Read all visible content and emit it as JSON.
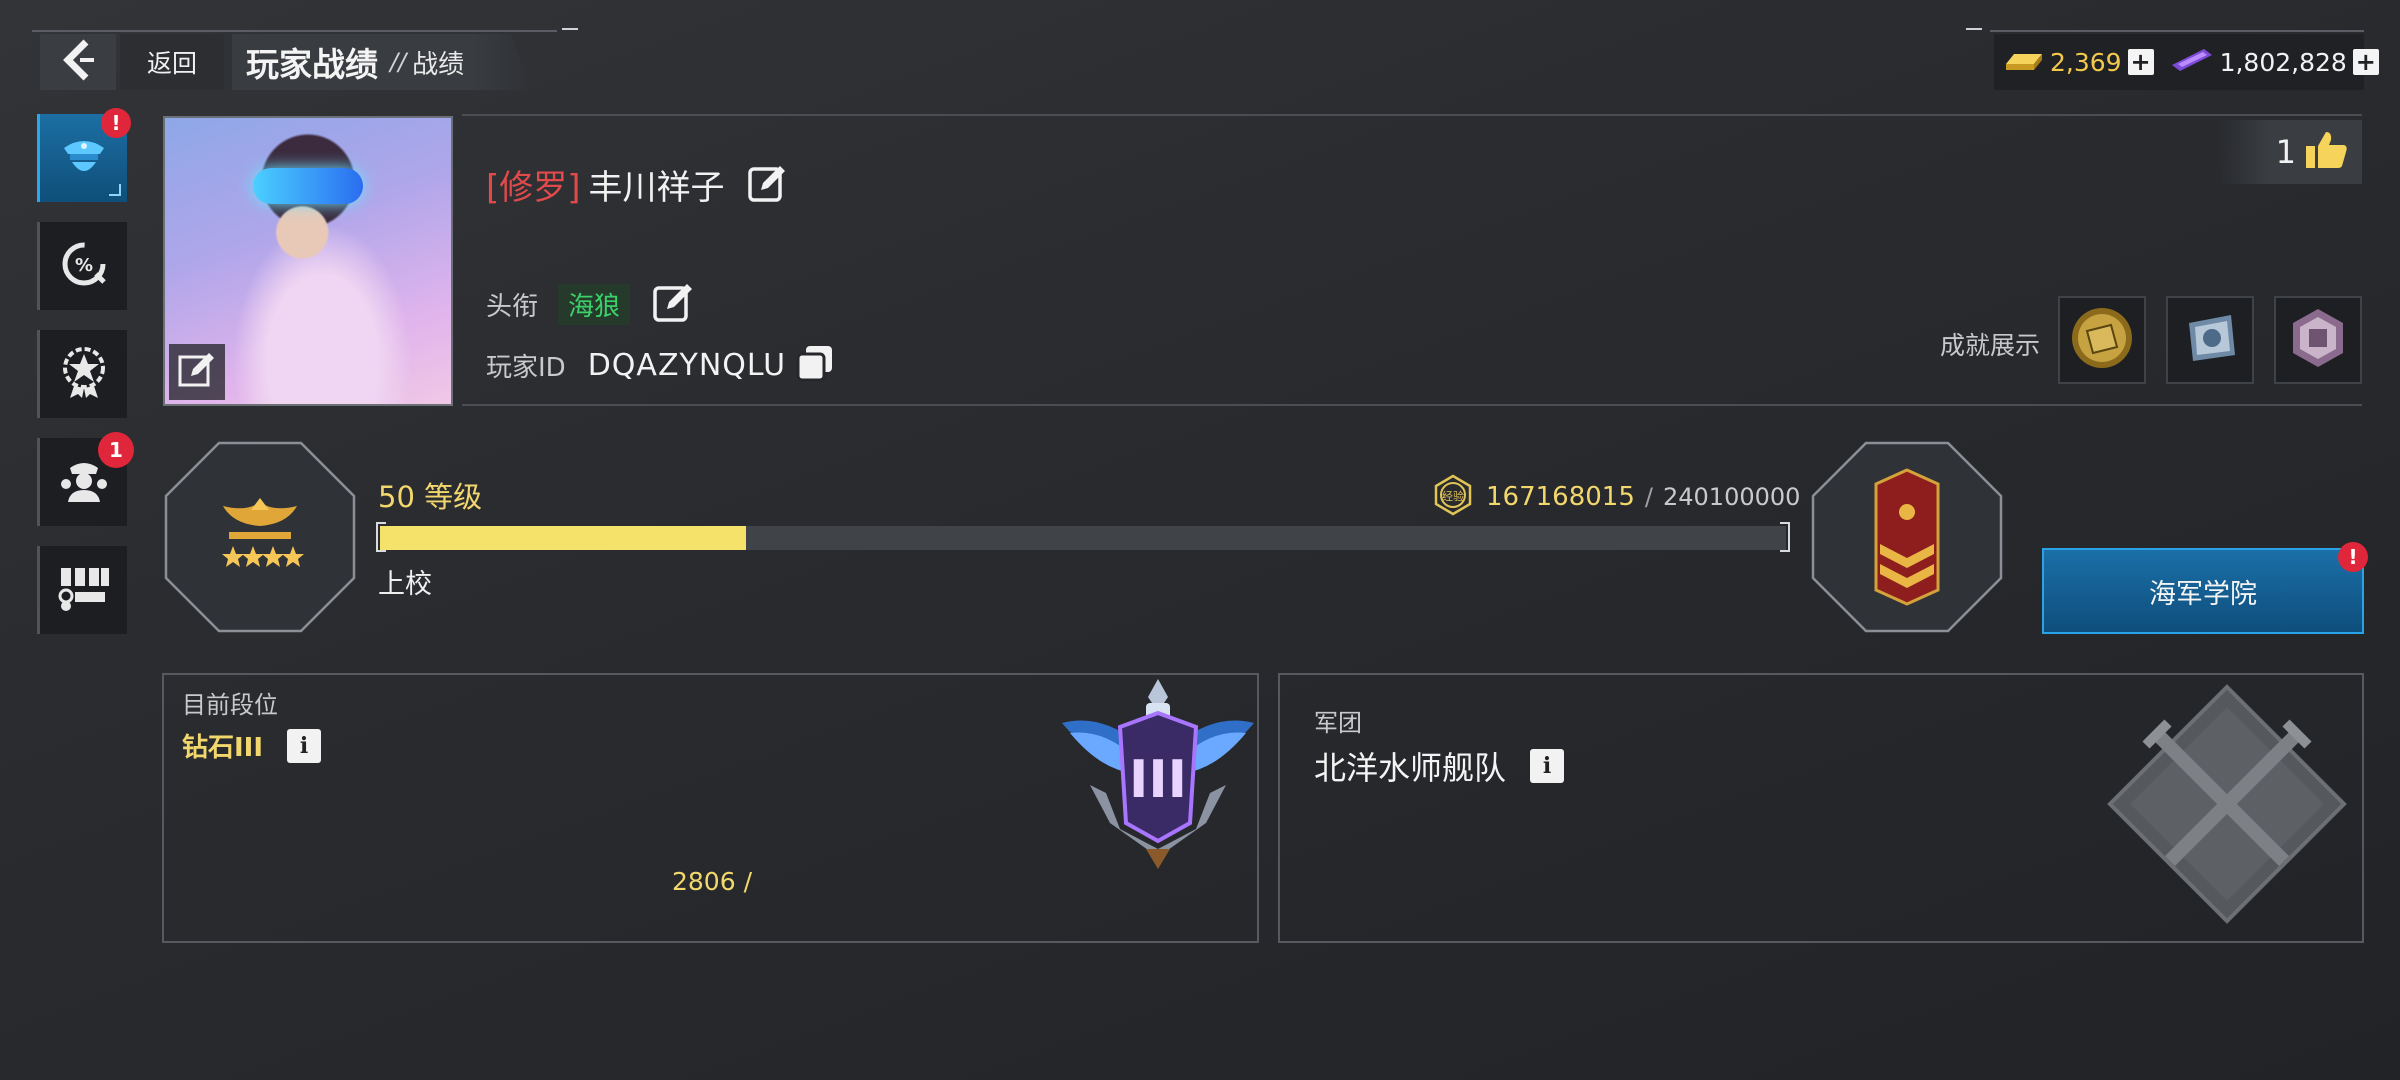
{
  "header": {
    "back_label": "返回",
    "title": "玩家战绩",
    "separator": "//",
    "subtitle": "战绩"
  },
  "currency": {
    "gold": "2,369",
    "gems": "1,802,828"
  },
  "nav": {
    "items": [
      {
        "icon": "officer-cap-icon",
        "badge": "!",
        "active": true
      },
      {
        "icon": "percent-gauge-icon",
        "badge": ""
      },
      {
        "icon": "medal-star-icon",
        "badge": ""
      },
      {
        "icon": "crew-icon",
        "badge": "1"
      },
      {
        "icon": "medals-rack-icon",
        "badge": ""
      }
    ]
  },
  "profile": {
    "name_tag": "[修罗]",
    "name": "丰川祥子",
    "title_label": "头衔",
    "title_value": "海狼",
    "id_label": "玩家ID",
    "id_value": "DQAZYNQLU",
    "likes": "1",
    "achievements_label": "成就展示"
  },
  "level": {
    "level_text": "50 等级",
    "exp_current": "167168015",
    "exp_slash": "/",
    "exp_max": "240100000",
    "progress": 0.26,
    "rank_name": "上校",
    "exp_icon_text": "经验"
  },
  "academy": {
    "label": "海军学院",
    "badge": "!"
  },
  "season": {
    "title": "目前段位",
    "tier": "钻石III",
    "points": "2806 /",
    "emblem_numeral": "III"
  },
  "legion": {
    "title": "军团",
    "name": "北洋水师舰队"
  },
  "colors": {
    "accent_blue": "#1b6fa8",
    "gold_text": "#f2d86c",
    "progress_fill": "#f4e26a",
    "name_tag": "#e04a4a",
    "title_green": "#3bd16a",
    "badge_red": "#e0263a"
  }
}
